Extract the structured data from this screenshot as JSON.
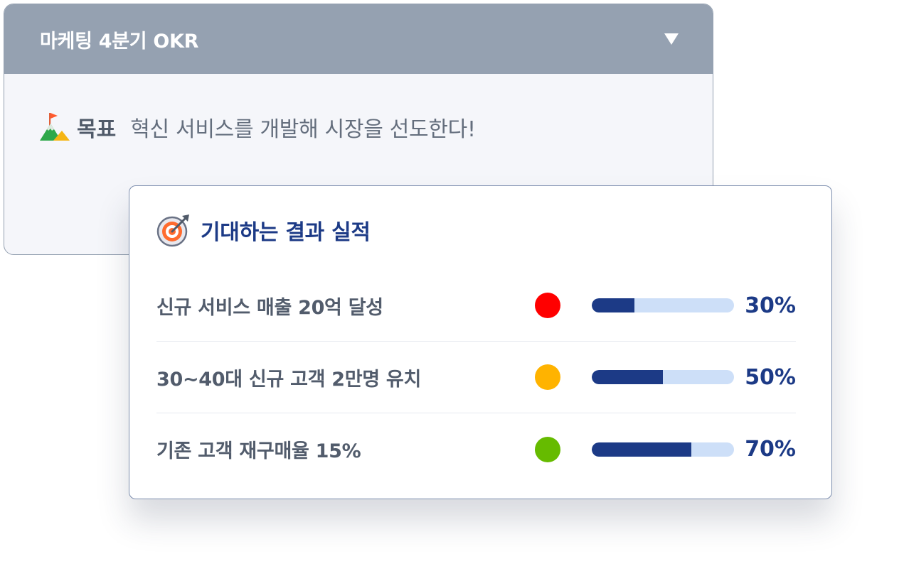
{
  "okr": {
    "title": "마케팅 4분기 OKR",
    "toggle_icon": "triangle-down-icon",
    "objective": {
      "icon": "mountain-flag-icon",
      "label": "목표",
      "text": "혁신 서비스를 개발해 시장을 선도한다!"
    }
  },
  "key_results": {
    "icon": "target-dart-icon",
    "heading": "기대하는 결과 실적",
    "items": [
      {
        "name": "신규 서비스 매출 20억 달성",
        "status_color": "#ff0000",
        "progress": 0.3,
        "percent_label": "30%"
      },
      {
        "name": "30~40대 신규 고객 2만명 유치",
        "status_color": "#ffb300",
        "progress": 0.5,
        "percent_label": "50%"
      },
      {
        "name": "기존 고객 재구매율 15%",
        "status_color": "#66bb00",
        "progress": 0.7,
        "percent_label": "70%"
      }
    ]
  },
  "colors": {
    "header_bg": "#95a1b1",
    "accent_navy": "#1c3a86",
    "bar_track": "#cddff8"
  }
}
